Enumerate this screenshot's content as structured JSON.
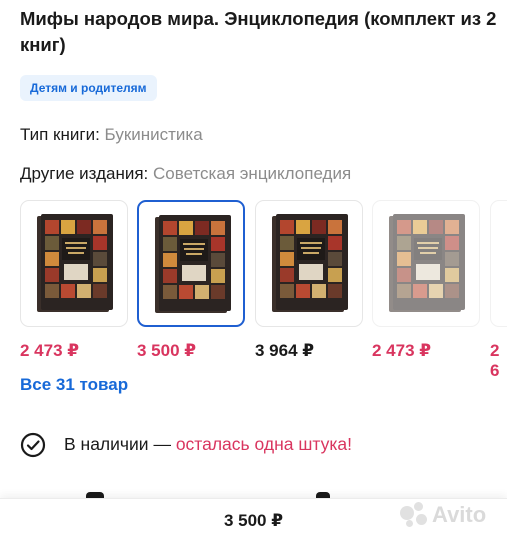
{
  "product": {
    "title": "Мифы народов мира. Энциклопедия (комплект из 2 книг)",
    "tag": "Детям и родителям"
  },
  "specs": {
    "type_label": "Тип книги:",
    "type_value": "Букинистика",
    "editions_label": "Другие издания:",
    "editions_value": "Советская энциклопедия"
  },
  "editions": [
    {
      "price": "2 473 ₽",
      "price_color": "#d9355f",
      "selected": false
    },
    {
      "price": "3 500 ₽",
      "price_color": "#d9355f",
      "selected": true
    },
    {
      "price": "3 964 ₽",
      "price_color": "#1a1a1a",
      "selected": false
    },
    {
      "price": "2 473 ₽",
      "price_color": "#d9355f",
      "selected": false
    },
    {
      "price": "2 6",
      "price_color": "#d9355f",
      "selected": false
    }
  ],
  "all_link": "Все 31 товар",
  "stock": {
    "status": "В наличии — ",
    "remaining": "осталась одна штука!"
  },
  "bottom_bar": {
    "price": "3 500 ₽"
  },
  "watermark": "Avito",
  "colors": {
    "accent_blue": "#1769d8",
    "price_red": "#d9355f",
    "selected_border": "#1f5fd1",
    "chip_bg": "#eaf3fd"
  }
}
